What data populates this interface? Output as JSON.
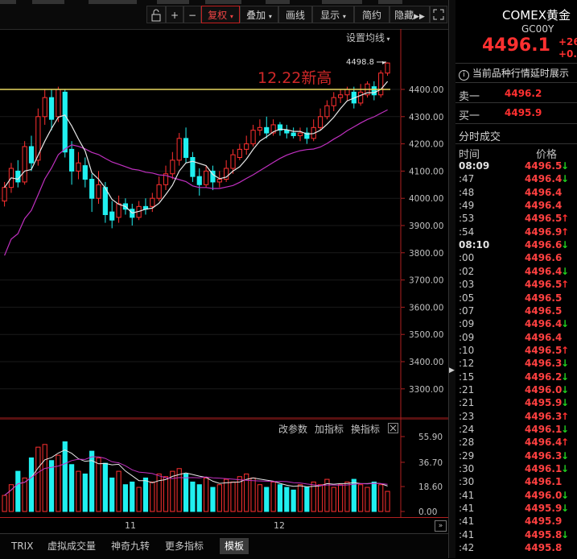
{
  "toolbar": {
    "fuquan_label": "复权",
    "diejia_label": "叠加",
    "huaxian_label": "画线",
    "xianshi_label": "显示",
    "jiandong_label": "简约",
    "yincang_label": "隐藏"
  },
  "main_chart": {
    "ma_settings_label": "设置均线",
    "high_label": "4498.8",
    "annotation": "12.22新高",
    "resistance_level": 4400,
    "y_ticks": [
      "4400.00",
      "4300.00",
      "4200.00",
      "4100.00",
      "4000.00",
      "3900.00",
      "3800.00",
      "3700.00",
      "3600.00",
      "3500.00",
      "3400.00",
      "3300.00"
    ]
  },
  "volume_panel": {
    "gaicanshu": "改参数",
    "jiazhibiao": "加指标",
    "huanzhibiao": "换指标",
    "y_ticks": [
      "55.90",
      "36.70",
      "18.60",
      "0.00"
    ]
  },
  "x_axis": {
    "labels": [
      "11",
      "12"
    ]
  },
  "bottom_tabs": [
    "TRIX",
    "虚拟成交量",
    "神奇九转",
    "更多指标",
    "模板"
  ],
  "right_panel": {
    "name": "COMEX黄金",
    "code": "GC00Y",
    "price": "4496.1",
    "change": "+26",
    "change_pct": "+0.",
    "delay_notice": "当前品种行情延时展示",
    "sell1_label": "卖一",
    "sell1_price": "4496.2",
    "buy1_label": "买一",
    "buy1_price": "4495.9",
    "section_title": "分时成交",
    "col_time": "时间",
    "col_price": "价格",
    "ticks": [
      {
        "time": "08:09",
        "price": "4496.5",
        "dir": "down",
        "bold": true
      },
      {
        "time": ":47",
        "price": "4496.4",
        "dir": "down"
      },
      {
        "time": ":48",
        "price": "4496.4",
        "dir": ""
      },
      {
        "time": ":49",
        "price": "4496.4",
        "dir": ""
      },
      {
        "time": ":53",
        "price": "4496.5",
        "dir": "up"
      },
      {
        "time": ":54",
        "price": "4496.9",
        "dir": "up"
      },
      {
        "time": "08:10",
        "price": "4496.6",
        "dir": "down",
        "bold": true
      },
      {
        "time": ":00",
        "price": "4496.6",
        "dir": ""
      },
      {
        "time": ":02",
        "price": "4496.4",
        "dir": "down"
      },
      {
        "time": ":03",
        "price": "4496.5",
        "dir": "up"
      },
      {
        "time": ":05",
        "price": "4496.5",
        "dir": ""
      },
      {
        "time": ":07",
        "price": "4496.5",
        "dir": ""
      },
      {
        "time": ":09",
        "price": "4496.4",
        "dir": "down"
      },
      {
        "time": ":09",
        "price": "4496.4",
        "dir": ""
      },
      {
        "time": ":10",
        "price": "4496.5",
        "dir": "up"
      },
      {
        "time": ":12",
        "price": "4496.3",
        "dir": "down"
      },
      {
        "time": ":15",
        "price": "4496.2",
        "dir": "down"
      },
      {
        "time": ":21",
        "price": "4496.0",
        "dir": "down"
      },
      {
        "time": ":21",
        "price": "4495.9",
        "dir": "down"
      },
      {
        "time": ":23",
        "price": "4496.3",
        "dir": "up"
      },
      {
        "time": ":24",
        "price": "4496.1",
        "dir": "down"
      },
      {
        "time": ":28",
        "price": "4496.4",
        "dir": "up"
      },
      {
        "time": ":29",
        "price": "4496.3",
        "dir": "down"
      },
      {
        "time": ":30",
        "price": "4496.1",
        "dir": "down"
      },
      {
        "time": ":30",
        "price": "4496.1",
        "dir": ""
      },
      {
        "time": ":41",
        "price": "4496.0",
        "dir": "down"
      },
      {
        "time": ":41",
        "price": "4495.9",
        "dir": "down"
      },
      {
        "time": ":41",
        "price": "4495.9",
        "dir": ""
      },
      {
        "time": ":41",
        "price": "4495.8",
        "dir": "down"
      },
      {
        "time": ":42",
        "price": "4495.8",
        "dir": ""
      }
    ]
  },
  "colors": {
    "up": "#ff3030",
    "down": "#20f0f0",
    "ma5": "#e8e8e8",
    "ma20": "#c030c0",
    "resistance": "#e8d860",
    "bg": "#000000"
  }
}
